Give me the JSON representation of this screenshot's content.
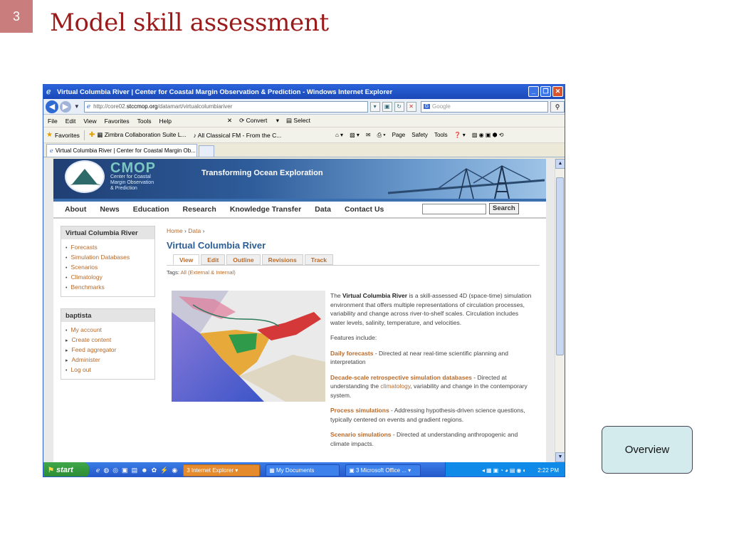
{
  "slide": {
    "number": "3",
    "title": "Model skill assessment",
    "overview_button": "Overview"
  },
  "browser": {
    "window_title": "Virtual Columbia River | Center for Coastal Margin Observation & Prediction - Windows Internet Explorer",
    "address": {
      "prefix": "http://core02.",
      "host": "stccmop.org",
      "path": "/datamart/virtualcolumbiariver"
    },
    "search_placeholder": "Google",
    "menu": [
      "File",
      "Edit",
      "View",
      "Favorites",
      "Tools",
      "Help"
    ],
    "toolbar_extra": {
      "convert": "Convert",
      "select": "Select"
    },
    "favorites": {
      "label": "Favorites",
      "items": [
        "Zimbra Collaboration Suite L...",
        "All Classical FM - From the C..."
      ]
    },
    "command_bar": [
      "Page",
      "Safety",
      "Tools"
    ],
    "tab_title": "Virtual Columbia River | Center for Coastal Margin Ob..."
  },
  "site": {
    "logo_name": "CMOP",
    "logo_sub": [
      "Center for Coastal",
      "Margin Observation",
      "& Prediction"
    ],
    "tagline": "Transforming Ocean Exploration",
    "nav": [
      "About",
      "News",
      "Education",
      "Research",
      "Knowledge Transfer",
      "Data",
      "Contact Us"
    ],
    "search_button": "Search"
  },
  "sidebar": {
    "box1": {
      "title": "Virtual Columbia River",
      "items": [
        "Forecasts",
        "Simulation Databases",
        "Scenarios",
        "Climatology",
        "Benchmarks"
      ]
    },
    "box2": {
      "title": "baptista",
      "items": [
        "My account",
        "Create content",
        "Feed aggregator",
        "Administer",
        "Log out"
      ]
    }
  },
  "main": {
    "breadcrumb": [
      "Home",
      "Data"
    ],
    "heading": "Virtual Columbia River",
    "tabs": [
      "View",
      "Edit",
      "Outline",
      "Revisions",
      "Track"
    ],
    "tags_label": "Tags:",
    "tags_value": "All (External & Internal)",
    "intro_pre": "The ",
    "intro_bold": "Virtual Columbia River",
    "intro_post": " is a skill-assessed 4D (space-time) simulation environment that offers multiple representations of circulation processes, variability and change across river-to-shelf scales. Circulation includes water levels, salinity, temperature, and velocities.",
    "features_label": "Features include:",
    "f1_title": "Daily forecasts",
    "f1_text": " - Directed at near real-time scientific planning and interpretation",
    "f2_title": "Decade-scale retrospective simulation databases",
    "f2_text_a": " - Directed at understanding the ",
    "f2_link": "climatology",
    "f2_text_b": ", variability and change in the contemporary system.",
    "f3_title": "Process simulations",
    "f3_text": " - Addressing hypothesis-driven science questions, typically centered on events and gradient regions.",
    "f4_title": "Scenario simulations",
    "f4_text": " - Directed at understanding anthropogenic and climate impacts."
  },
  "taskbar": {
    "start": "start",
    "tasks": [
      "3 Internet Explorer",
      "My Documents",
      "3 Microsoft Office ..."
    ],
    "clock": "2:22 PM"
  }
}
